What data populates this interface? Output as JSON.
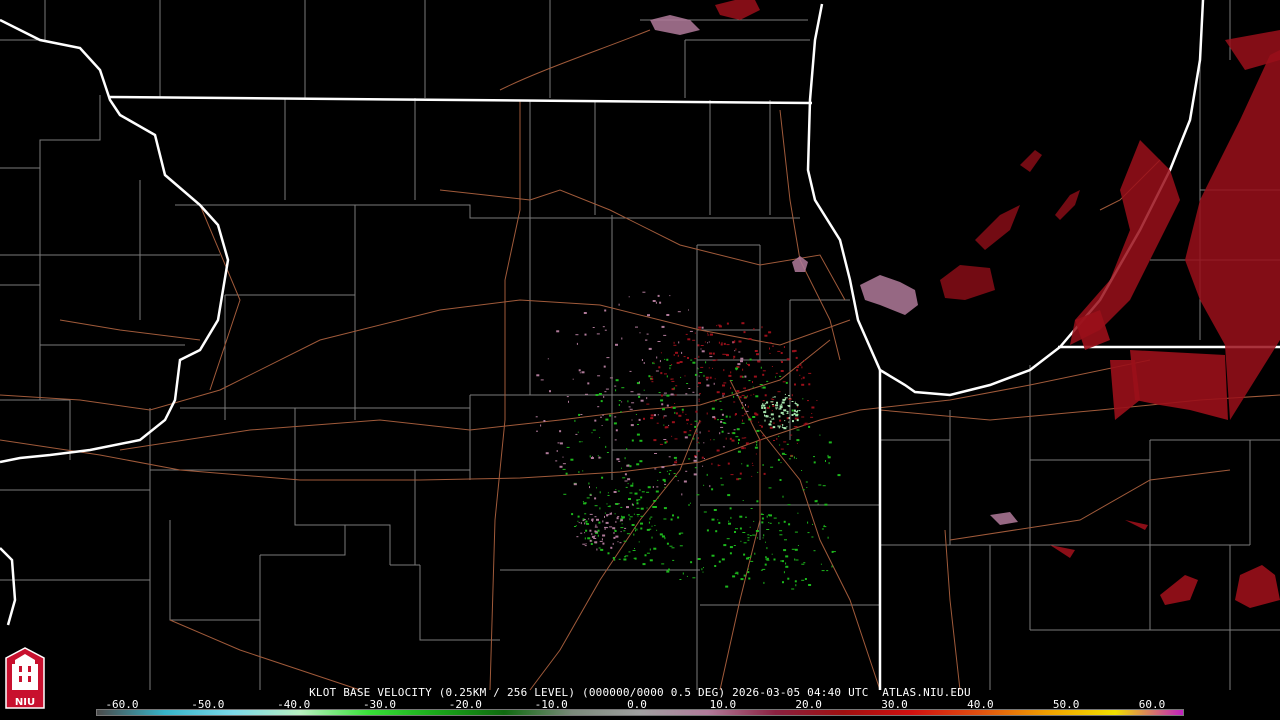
{
  "product": {
    "title": "KLOT BASE VELOCITY (0.25KM / 256 LEVEL) (000000/0000 0.5 DEG) 2026-03-05 04:40 UTC  ATLAS.NIU.EDU"
  },
  "colorbar": {
    "ticks": [
      "-60.0",
      "-50.0",
      "-40.0",
      "-30.0",
      "-20.0",
      "-10.0",
      "0.0",
      "10.0",
      "20.0",
      "30.0",
      "40.0",
      "50.0",
      "60.0"
    ],
    "stops": [
      "#4a4a4a",
      "#36b4c8",
      "#7ad8e8",
      "#b8f0c0",
      "#38e038",
      "#1aa81a",
      "#0f6a0f",
      "#7a8a7a",
      "#a0a0a0",
      "#b07a9a",
      "#8a2040",
      "#a01010",
      "#d01010",
      "#e05010",
      "#f0a000",
      "#f0e000",
      "#c020c0"
    ]
  },
  "logo": {
    "text": "NIU",
    "color": "#c8102e"
  },
  "map_colors": {
    "state_border": "#ffffff",
    "county_line": "#7a7a7a",
    "highway": "#a05a3a",
    "inbound_echo": "#1db81d",
    "outbound_echo": "#9a0f1a",
    "weak_echo": "#b07a9a"
  }
}
